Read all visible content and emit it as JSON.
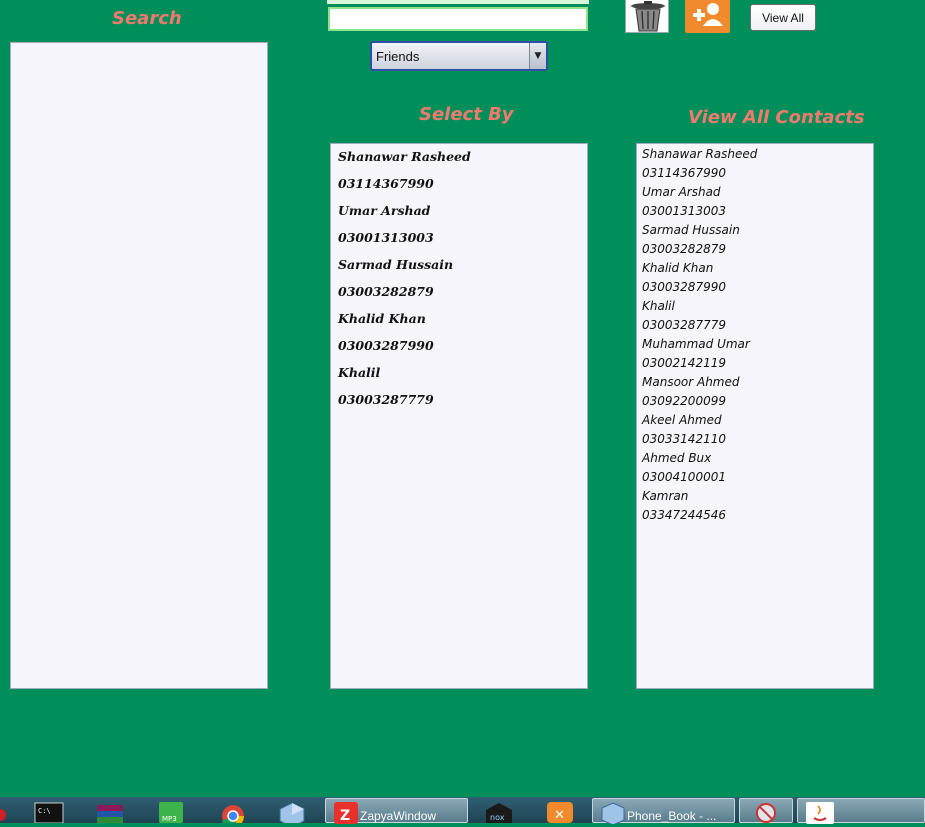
{
  "search": {
    "heading": "Search",
    "input_value": ""
  },
  "category": {
    "selected": "Friends"
  },
  "toolbar": {
    "delete_icon": "trash-can-icon",
    "add_icon": "add-user-icon",
    "view_all_label": "View All"
  },
  "select_by": {
    "heading": "Select By",
    "items": [
      "Shanawar Rasheed",
      "03114367990",
      "Umar Arshad",
      "03001313003",
      "Sarmad Hussain",
      "03003282879",
      "Khalid Khan",
      "03003287990",
      "Khalil",
      "03003287779"
    ]
  },
  "view_all": {
    "heading": "View All Contacts",
    "items": [
      "Shanawar Rasheed",
      "03114367990",
      "Umar Arshad",
      "03001313003",
      "Sarmad Hussain",
      "03003282879",
      "Khalid Khan",
      "03003287990",
      "Khalil",
      "03003287779",
      "Muhammad Umar",
      "03002142119",
      "Mansoor Ahmed",
      "03092200099",
      "Akeel Ahmed",
      "03033142110",
      "Ahmed Bux",
      "03004100001",
      "Kamran",
      "03347244546"
    ]
  },
  "taskbar": {
    "pinned_icons": [
      "cmd-icon",
      "winrar-icon",
      "mp3-icon",
      "chrome-icon",
      "virtualbox-icon",
      "nox-icon",
      "xampp-icon",
      "network-icon",
      "java-icon"
    ],
    "tasks": [
      {
        "label": "ZapyaWindow"
      },
      {
        "label": "Phone_Book - ..."
      }
    ]
  },
  "colors": {
    "background": "#008f5a",
    "heading": "#f07a6e",
    "add_button": "#f08a2c"
  }
}
